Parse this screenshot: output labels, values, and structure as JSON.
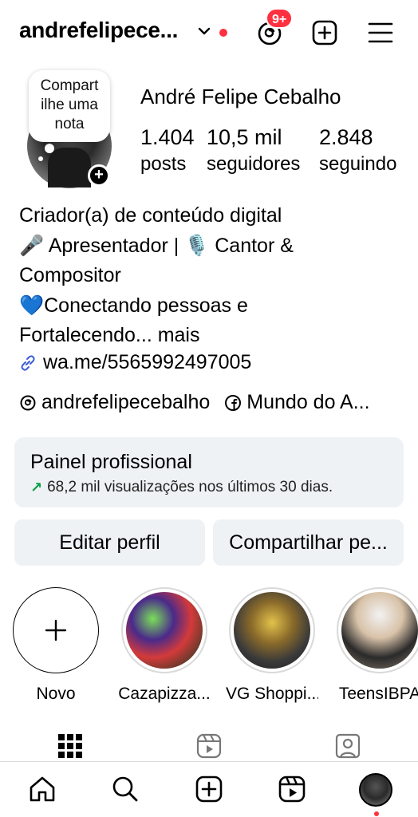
{
  "header": {
    "username": "andrefelipece...",
    "notifications_badge": "9+"
  },
  "profile": {
    "note": "Compart ilhe uma nota",
    "full_name": "André Felipe Cebalho",
    "stats": {
      "posts_value": "1.404",
      "posts_label": "posts",
      "followers_value": "10,5 mil",
      "followers_label": "seguidores",
      "following_value": "2.848",
      "following_label": "seguindo"
    },
    "bio": {
      "line1": "Criador(a) de conteúdo digital",
      "line2": "🎤 Apresentador | 🎙️ Cantor &",
      "line3": "Compositor",
      "line4": "💙Conectando pessoas e",
      "line5": "Fortalecendo... mais"
    },
    "link": "wa.me/5565992497005",
    "threads_handle": "andrefelipecebalho",
    "facebook_page": "Mundo do A..."
  },
  "panel": {
    "title": "Painel profissional",
    "subtitle": "68,2 mil visualizações nos últimos 30 dias."
  },
  "buttons": {
    "edit": "Editar perfil",
    "share": "Compartilhar pe..."
  },
  "highlights": [
    {
      "label": "Novo"
    },
    {
      "label": "Cazapizza..."
    },
    {
      "label": "VG Shoppi..."
    },
    {
      "label": "TeensIBPA"
    }
  ],
  "colors": {
    "badge_red": "#ff3040",
    "panel_bg": "#eff2f5",
    "trend_green": "#0a9e4a",
    "link_blue": "#3a5bd9"
  }
}
